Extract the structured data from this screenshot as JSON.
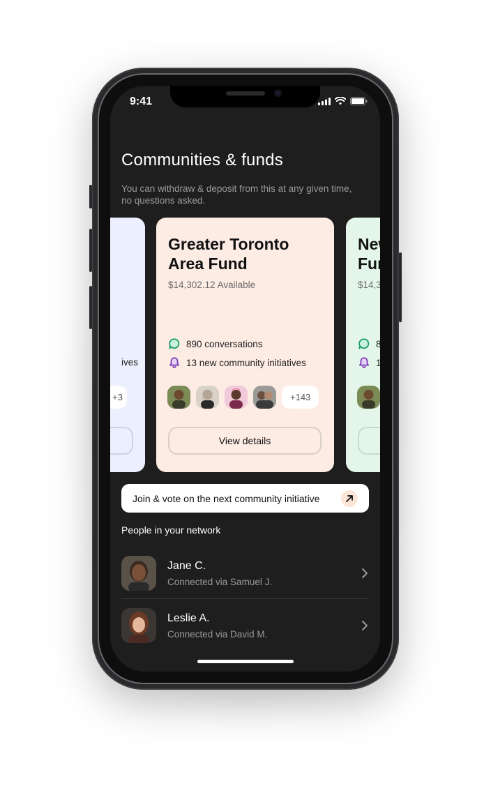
{
  "status_bar": {
    "time": "9:41"
  },
  "header": {
    "title": "Communities & funds",
    "subtitle": "You can withdraw & deposit from this at any given time, no questions asked."
  },
  "cards": {
    "left": {
      "stat_partial": "ives",
      "more_partial": "+3"
    },
    "main": {
      "title": "Greater Toronto Area Fund",
      "available": "$14,302.12 Available",
      "conversations": "890 conversations",
      "initiatives": "13 new community initiatives",
      "more_members": "+143",
      "button": "View details"
    },
    "right": {
      "title_partial": "New Fun",
      "available_partial": "$14,3",
      "conv_partial": "8",
      "init_partial": "1"
    }
  },
  "join_banner": {
    "label": "Join & vote on the next community initiative"
  },
  "network": {
    "heading": "People in your network",
    "people": [
      {
        "name": "Jane C.",
        "connection": "Connected via Samuel J."
      },
      {
        "name": "Leslie A.",
        "connection": "Connected via David M."
      }
    ]
  },
  "colors": {
    "screen_bg": "#1e1e1e",
    "card_main_bg": "#fdece4",
    "card_left_bg": "#eceffd",
    "card_right_bg": "#e4f6ea",
    "chat_icon": "#1f9d6a",
    "bell_icon": "#9b59d0"
  },
  "icons": [
    "chat-bubble-icon",
    "bell-icon",
    "arrow-up-right-icon",
    "chevron-right-icon",
    "signal-icon",
    "wifi-icon",
    "battery-icon"
  ]
}
